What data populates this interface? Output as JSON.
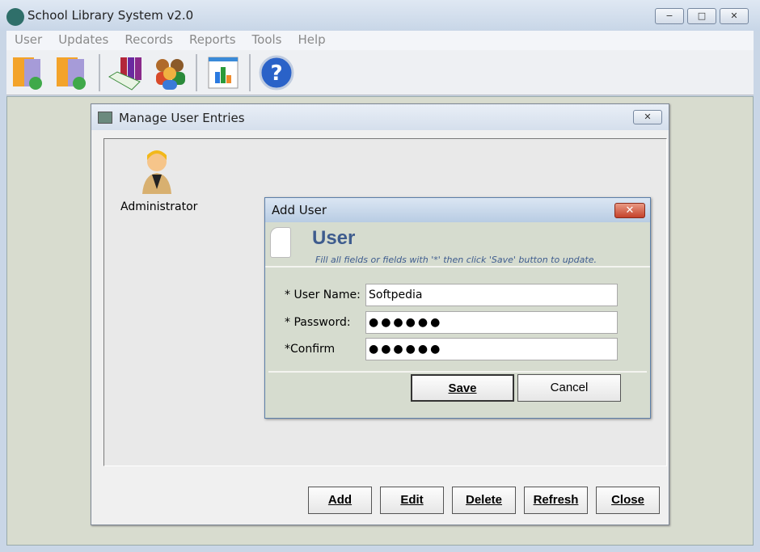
{
  "window": {
    "title": "School Library System v2.0",
    "minimize": "−",
    "maximize": "□",
    "close": "✕"
  },
  "menu": [
    "User",
    "Updates",
    "Records",
    "Reports",
    "Tools",
    "Help"
  ],
  "toolbar": [
    "book-export-icon",
    "book-import-icon",
    "books-records-icon",
    "users-icon",
    "report-chart-icon",
    "help-icon"
  ],
  "manage": {
    "title": "Manage User Entries",
    "close": "✕",
    "users": [
      {
        "name": "Administrator"
      }
    ],
    "buttons": {
      "add": "Add",
      "edit": "Edit",
      "delete": "Delete",
      "refresh": "Refresh",
      "close": "Close"
    }
  },
  "add_user": {
    "title": "Add User",
    "close": "✕",
    "heading": "User",
    "subtitle": "Fill all fields or fields with '*' then click 'Save' button to update.",
    "username_label": "* User Name:",
    "username_value": "Softpedia",
    "password_label": "* Password:",
    "password_value": "●●●●●●",
    "confirm_label": "*Confirm",
    "confirm_value": "●●●●●●",
    "save": "Save",
    "cancel": "Cancel"
  }
}
